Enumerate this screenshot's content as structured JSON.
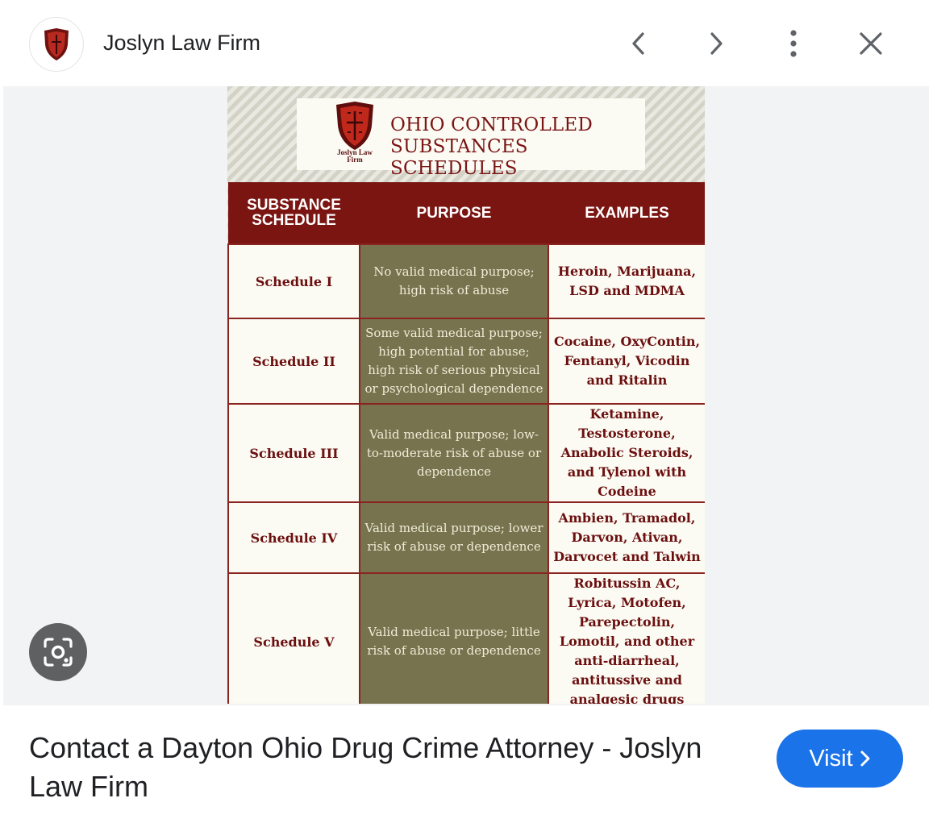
{
  "header": {
    "site_name": "Joslyn Law Firm",
    "icons": [
      "shield-logo-icon",
      "chevron-left-icon",
      "chevron-right-icon",
      "more-vert-icon",
      "close-icon"
    ]
  },
  "infographic": {
    "brand": "Joslyn Law Firm",
    "title_line1": "OHIO CONTROLLED",
    "title_line2": "SUBSTANCES SCHEDULES",
    "columns": [
      "SUBSTANCE SCHEDULE",
      "PURPOSE",
      "EXAMPLES"
    ],
    "rows": [
      {
        "schedule": "Schedule I",
        "purpose": "No valid medical purpose; high risk of abuse",
        "examples": "Heroin, Marijuana, LSD and MDMA"
      },
      {
        "schedule": "Schedule II",
        "purpose": "Some valid medical purpose; high potential for abuse; high risk of serious physical or psychological dependence",
        "examples": "Cocaine, OxyContin, Fentanyl, Vicodin and Ritalin"
      },
      {
        "schedule": "Schedule III",
        "purpose": "Valid medical purpose; low-to-moderate risk of abuse or dependence",
        "examples": "Ketamine, Testosterone, Anabolic Steroids, and Tylenol with Codeine"
      },
      {
        "schedule": "Schedule IV",
        "purpose": "Valid medical purpose; lower risk of abuse or dependence",
        "examples": "Ambien, Tramadol, Darvon, Ativan, Darvocet and Talwin"
      },
      {
        "schedule": "Schedule V",
        "purpose": "Valid medical purpose; little risk of abuse or dependence",
        "examples": "Robitussin AC, Lyrica, Motofen, Parepectolin, Lomotil, and other anti-diarrheal, antitussive and analgesic drugs"
      }
    ]
  },
  "lens": {
    "icon": "visual-search-icon"
  },
  "footer": {
    "title": "Contact a Dayton Ohio Drug Crime Attorney - Joslyn Law Firm",
    "visit_label": "Visit"
  },
  "colors": {
    "accent": "#1a73e8",
    "header_red": "#7a1512",
    "purpose_olive": "#76734e"
  }
}
